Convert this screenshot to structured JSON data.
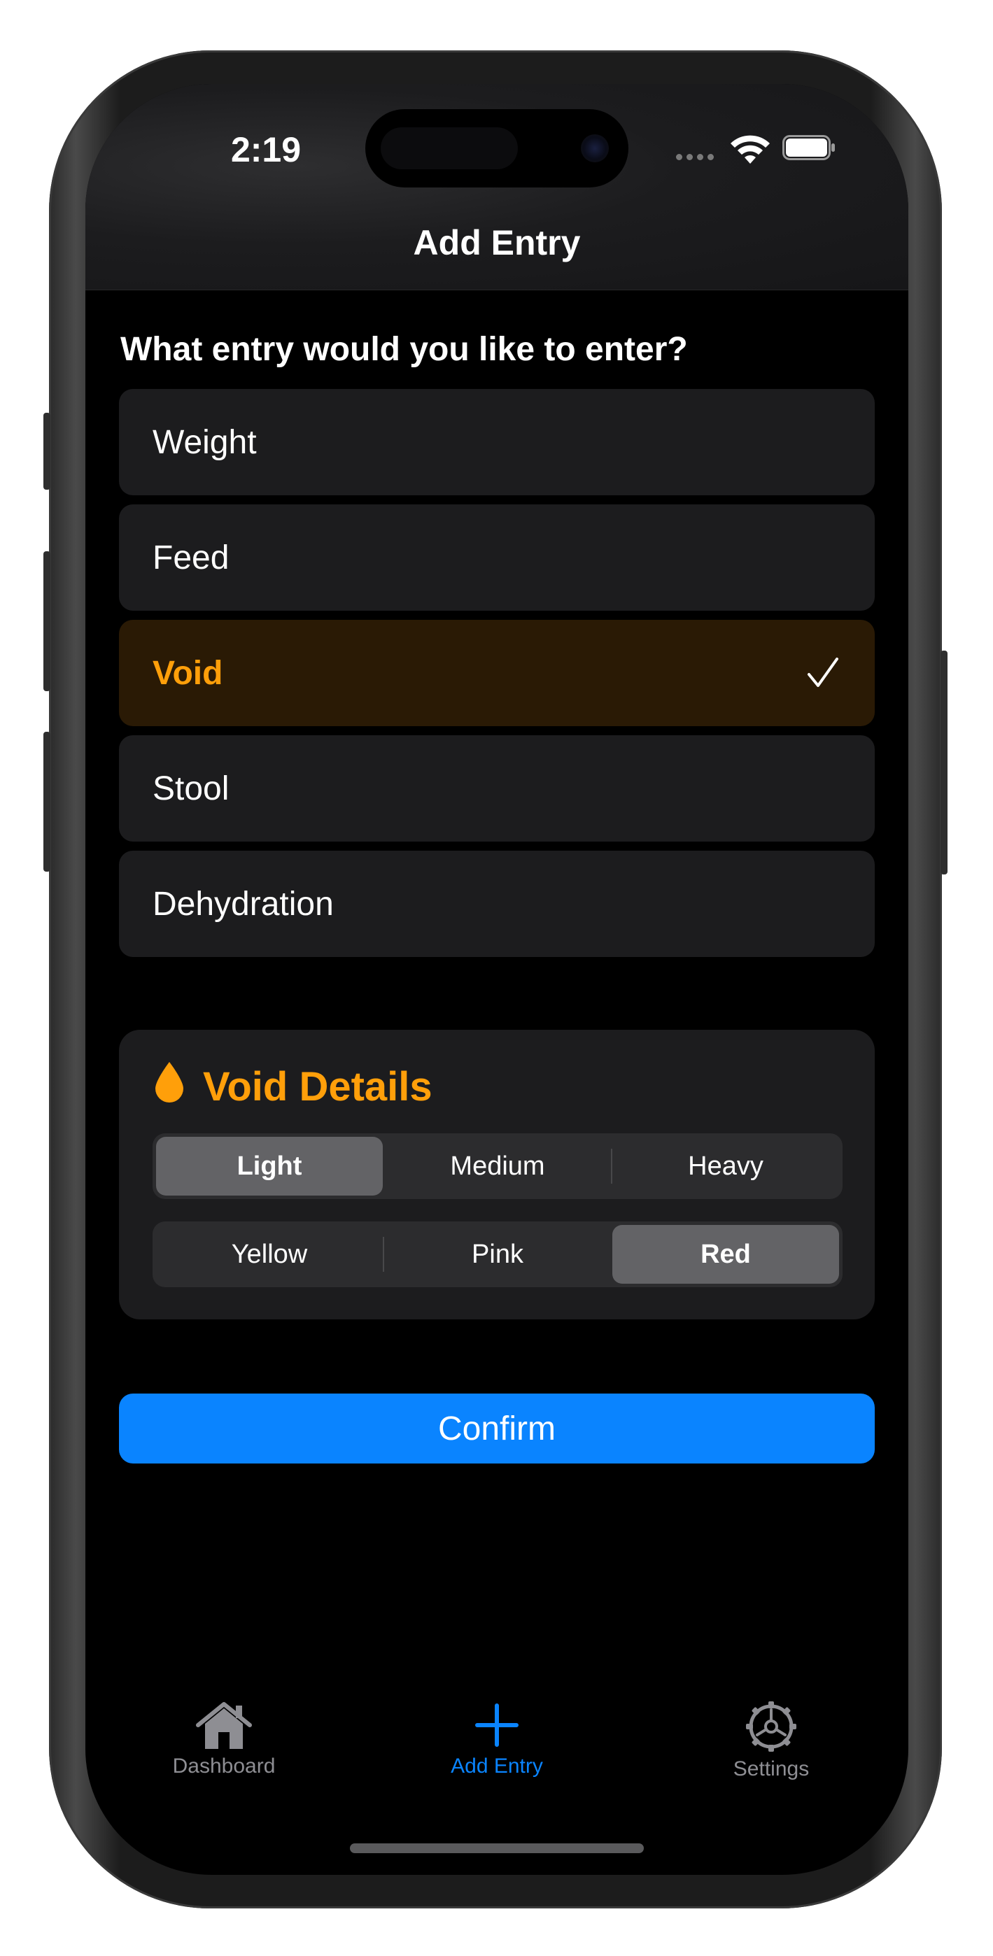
{
  "status_bar": {
    "time": "2:19"
  },
  "header": {
    "title": "Add Entry"
  },
  "prompt": "What entry would you like to enter?",
  "options": [
    {
      "label": "Weight",
      "selected": false
    },
    {
      "label": "Feed",
      "selected": false
    },
    {
      "label": "Void",
      "selected": true
    },
    {
      "label": "Stool",
      "selected": false
    },
    {
      "label": "Dehydration",
      "selected": false
    }
  ],
  "details": {
    "icon": "drop-icon",
    "title": "Void Details",
    "volume": {
      "options": [
        "Light",
        "Medium",
        "Heavy"
      ],
      "selected": "Light"
    },
    "color": {
      "options": [
        "Yellow",
        "Pink",
        "Red"
      ],
      "selected": "Red"
    }
  },
  "confirm_label": "Confirm",
  "tab_bar": {
    "items": [
      {
        "label": "Dashboard",
        "icon": "house-icon",
        "active": false
      },
      {
        "label": "Add Entry",
        "icon": "plus-icon",
        "active": true
      },
      {
        "label": "Settings",
        "icon": "gear-icon",
        "active": false
      }
    ]
  },
  "colors": {
    "accent": "#ff9f0a",
    "selected_row_bg": "#2a1a05",
    "tint": "#0a84ff",
    "row_bg": "#1c1c1e"
  }
}
